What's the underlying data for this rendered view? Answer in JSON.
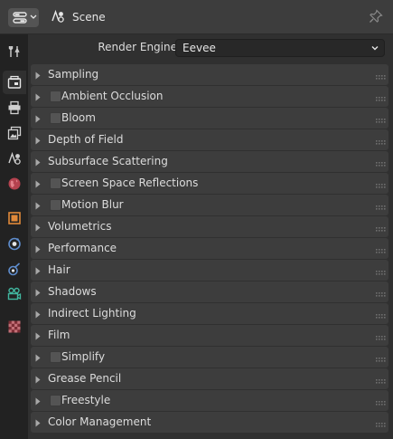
{
  "header": {
    "context_label": "Scene",
    "editor_type_icon": "properties-editor-icon",
    "context_icon": "scene-icon",
    "pin_icon": "pin-icon"
  },
  "tabs": [
    {
      "name": "tool",
      "icon": "wrench-screwdriver-icon",
      "active": false
    },
    {
      "name": "render",
      "icon": "camera-back-icon",
      "active": true
    },
    {
      "name": "output",
      "icon": "printer-icon",
      "active": false
    },
    {
      "name": "view-layer",
      "icon": "image-stack-icon",
      "active": false
    },
    {
      "name": "scene",
      "icon": "scene-icon",
      "active": false
    },
    {
      "name": "world",
      "icon": "world-icon",
      "active": false
    },
    {
      "name": "object",
      "icon": "object-square-icon",
      "active": false
    },
    {
      "name": "physics",
      "icon": "physics-icon",
      "active": false
    },
    {
      "name": "constraints",
      "icon": "constraint-icon",
      "active": false
    },
    {
      "name": "camera-data",
      "icon": "camera-data-icon",
      "active": false
    },
    {
      "name": "texture",
      "icon": "checker-icon",
      "active": false
    }
  ],
  "render_engine": {
    "label": "Render Engine",
    "value": "Eevee"
  },
  "sections": [
    {
      "title": "Sampling",
      "checkbox": false
    },
    {
      "title": "Ambient Occlusion",
      "checkbox": true
    },
    {
      "title": "Bloom",
      "checkbox": true
    },
    {
      "title": "Depth of Field",
      "checkbox": false
    },
    {
      "title": "Subsurface Scattering",
      "checkbox": false
    },
    {
      "title": "Screen Space Reflections",
      "checkbox": true
    },
    {
      "title": "Motion Blur",
      "checkbox": true
    },
    {
      "title": "Volumetrics",
      "checkbox": false
    },
    {
      "title": "Performance",
      "checkbox": false
    },
    {
      "title": "Hair",
      "checkbox": false
    },
    {
      "title": "Shadows",
      "checkbox": false
    },
    {
      "title": "Indirect Lighting",
      "checkbox": false
    },
    {
      "title": "Film",
      "checkbox": false
    },
    {
      "title": "Simplify",
      "checkbox": true
    },
    {
      "title": "Grease Pencil",
      "checkbox": false
    },
    {
      "title": "Freestyle",
      "checkbox": true
    },
    {
      "title": "Color Management",
      "checkbox": false
    }
  ]
}
